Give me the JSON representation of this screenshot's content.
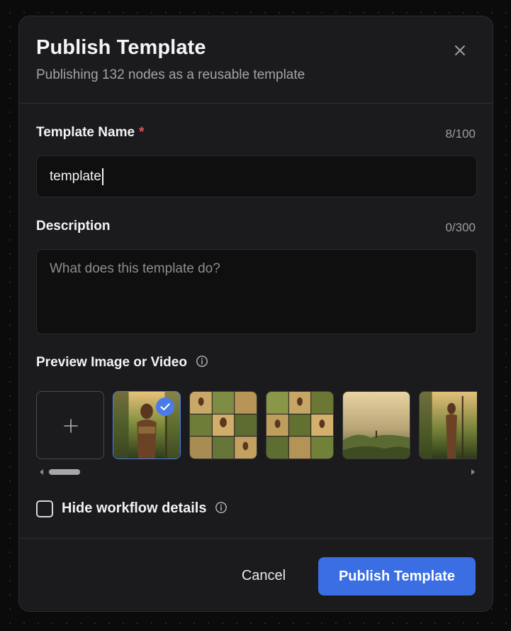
{
  "dialog": {
    "title": "Publish Template",
    "subtitle": "Publishing 132 nodes as a reusable template",
    "close_icon": "close-icon"
  },
  "template_name": {
    "label": "Template Name",
    "required_mark": "*",
    "counter": "8/100",
    "value": "template"
  },
  "description": {
    "label": "Description",
    "counter": "0/300",
    "placeholder": "What does this template do?"
  },
  "preview": {
    "label": "Preview Image or Video",
    "info_icon": "info-icon",
    "add_icon": "plus-icon",
    "selected_index": 0,
    "items": [
      {
        "name": "jungle-warrior-portrait",
        "selected": true
      },
      {
        "name": "jungle-warrior-grid-1",
        "selected": false
      },
      {
        "name": "jungle-warrior-grid-2",
        "selected": false
      },
      {
        "name": "misty-jungle-landscape",
        "selected": false
      },
      {
        "name": "jungle-warrior-standing",
        "selected": false
      }
    ]
  },
  "options": {
    "hide_workflow_label": "Hide workflow details",
    "hide_workflow_checked": false
  },
  "footer": {
    "cancel_label": "Cancel",
    "publish_label": "Publish Template"
  },
  "colors": {
    "accent": "#3b6ee2",
    "required": "#e05555",
    "background": "#1b1b1d"
  }
}
